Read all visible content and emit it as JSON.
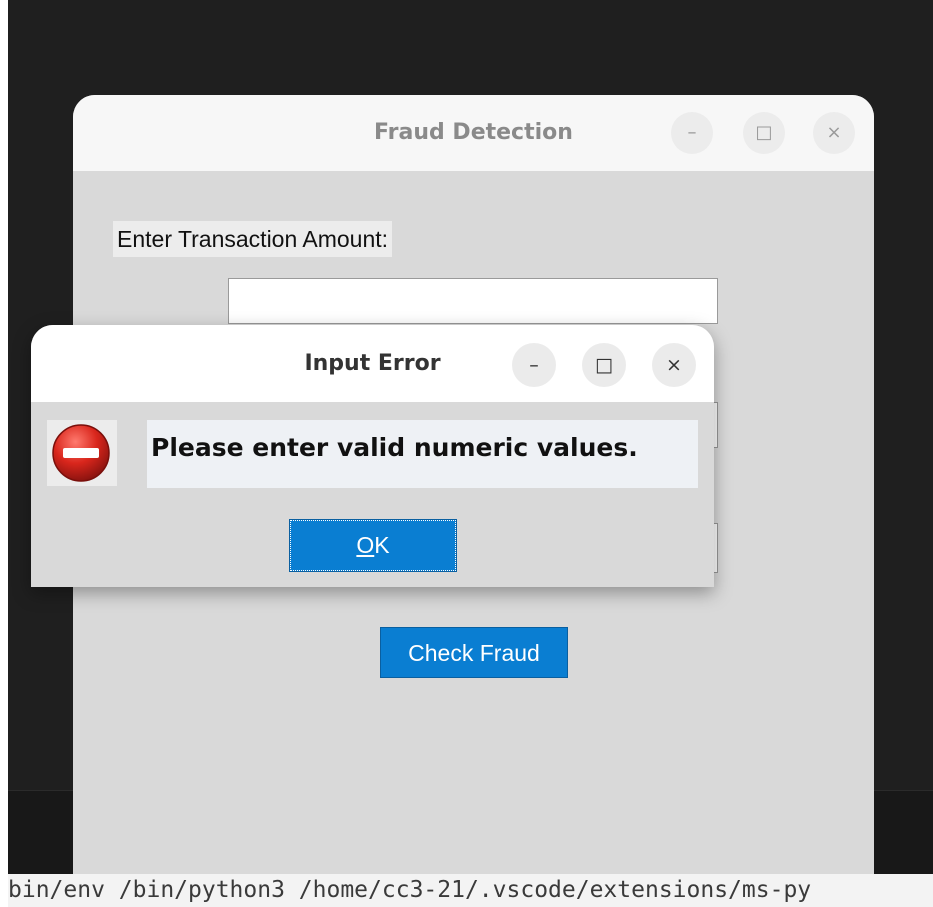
{
  "main_window": {
    "title": "Fraud Detection",
    "minimize_glyph": "–",
    "maximize_glyph": "□",
    "close_glyph": "×",
    "amount_label": "Enter Transaction Amount:",
    "amount_value": "",
    "check_button_label": "Check Fraud"
  },
  "dialog": {
    "title": "Input Error",
    "minimize_glyph": "–",
    "maximize_glyph": "□",
    "close_glyph": "×",
    "icon": "error-stop-icon",
    "message": "Please enter valid numeric values.",
    "ok_mnemonic": "O",
    "ok_rest": "K"
  },
  "terminal": {
    "line": "bin/env /bin/python3 /home/cc3-21/.vscode/extensions/ms-py"
  },
  "colors": {
    "button_blue": "#0a7ed2",
    "window_bg": "#d9d9d9",
    "desktop_bg": "#1f1f1f",
    "error_red": "#d9261c"
  }
}
